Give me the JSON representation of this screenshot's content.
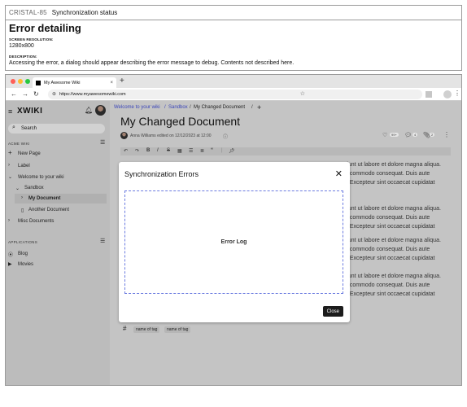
{
  "spec": {
    "ticket_id": "CRISTAL-85",
    "ticket_name": "Synchronization status",
    "heading": "Error detailing",
    "resolution_label": "SCREEN RESOLUTION:",
    "resolution_value": "1280x800",
    "description_label": "DESCRIPTION:",
    "description_value": "Accessing the error, a dialog should appear describing the error message to debug. Contents not described here."
  },
  "browser": {
    "tab_title": "My Awesome Wiki",
    "tab_close": "×",
    "new_tab": "+",
    "url": "https://www.myawesomewiki.com",
    "dots": [
      "#ff5f57",
      "#febc2e",
      "#28c840"
    ]
  },
  "sidebar": {
    "logo": "XWIKI",
    "search_placeholder": "Search",
    "section_label": "ACME WIKI",
    "new_page": "New Page",
    "items": [
      {
        "label": "Label"
      },
      {
        "label": "Welcome to your wiki"
      },
      {
        "label": "Sandbox"
      },
      {
        "label": "My Document"
      },
      {
        "label": "Another Document"
      },
      {
        "label": "Misc Documents"
      }
    ],
    "applications_label": "APPLICATIONS",
    "apps": [
      {
        "label": "Blog"
      },
      {
        "label": "Movies"
      }
    ]
  },
  "content": {
    "breadcrumb": [
      "Welcome to your wiki",
      "Sandbox",
      "My Changed Document"
    ],
    "title": "My Changed Document",
    "meta": "Anna Williams edited on 12/12/2023 at 12:00",
    "counts": {
      "likes": "99+",
      "comments": "4",
      "attachments": "2"
    },
    "body_lines": [
      "dunt ut labore et dolore magna aliqua.",
      "a commodo consequat. Duis aute",
      "r. Excepteur sint occaecat cupidatat",
      "dunt ut labore et dolore magna aliqua.",
      "a commodo consequat. Duis aute",
      "r. Excepteur sint occaecat cupidatat",
      "dunt ut labore et dolore magna aliqua.",
      "a commodo consequat. Duis aute",
      "r. Excepteur sint occaecat cupidatat",
      "dunt ut labore et dolore magna aliqua.",
      "a commodo consequat. Duis aute",
      "r. Excepteur sint occaecat cupidatat"
    ],
    "tags": [
      "name of tag",
      "name of tag"
    ]
  },
  "modal": {
    "title": "Synchronization Errors",
    "error_log": "Error Log",
    "close_label": "Close"
  }
}
